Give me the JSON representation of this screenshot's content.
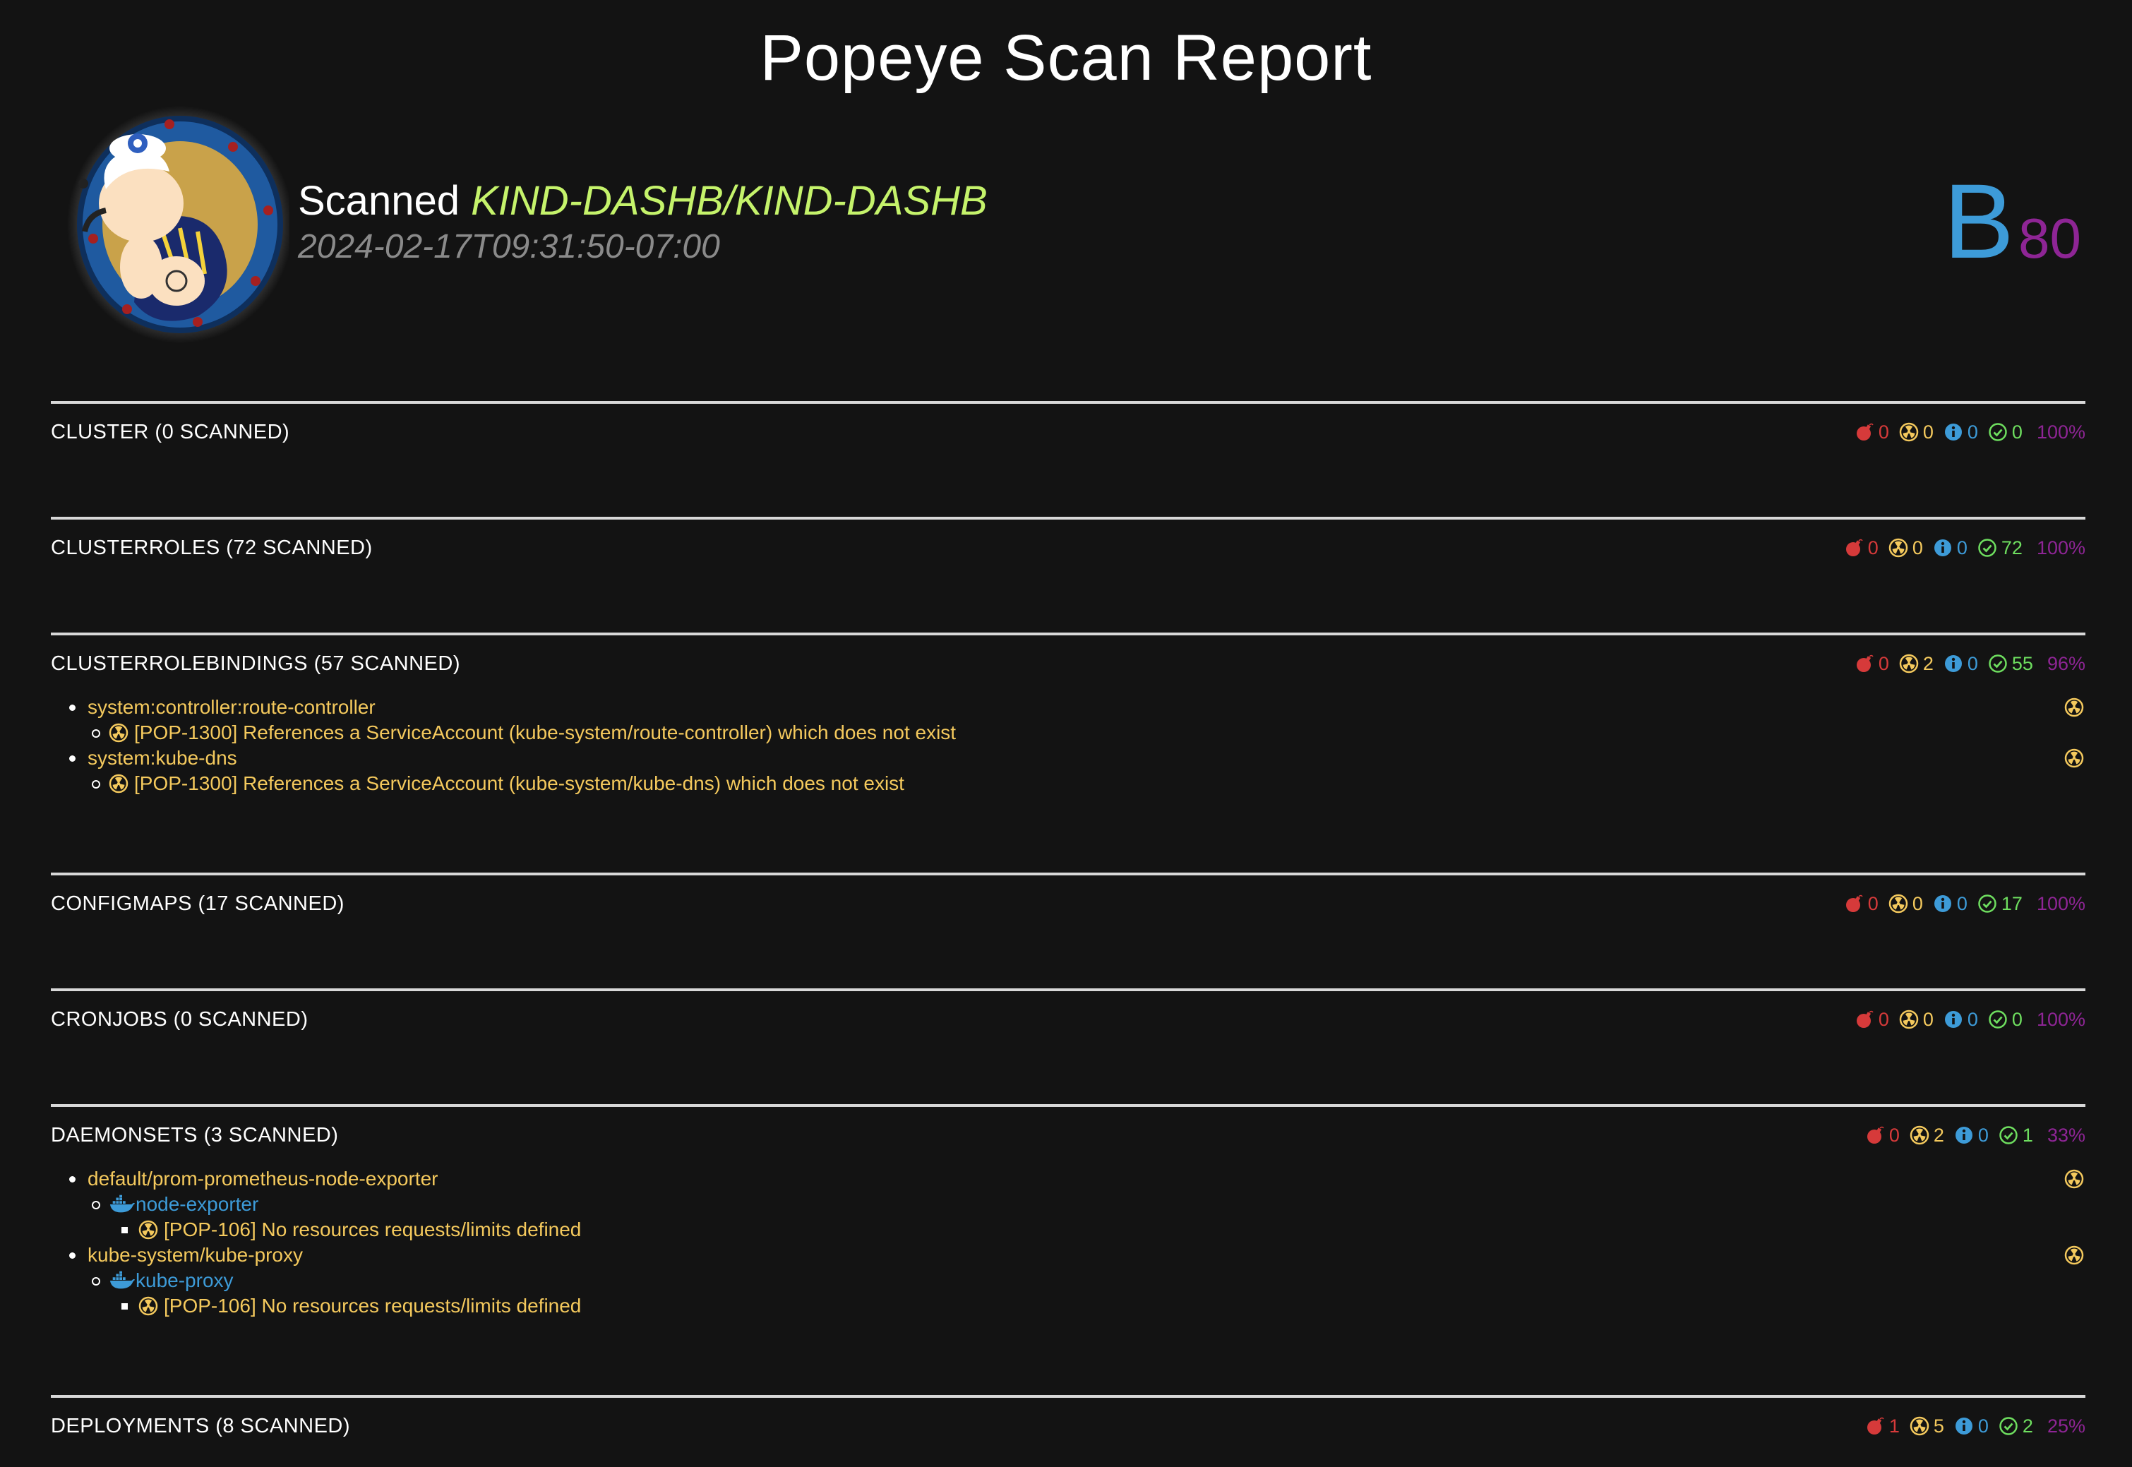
{
  "page": {
    "title": "Popeye Scan Report"
  },
  "header": {
    "scanned_label": "Scanned",
    "cluster": "KIND-DASHB/KIND-DASHB",
    "timestamp": "2024-02-17T09:31:50-07:00",
    "grade": "B",
    "score": "80"
  },
  "colors": {
    "background": "#131313",
    "error": "#d63a3a",
    "warning": "#f4c95d",
    "info": "#3d9bd8",
    "ok": "#6ede5f",
    "percent": "#8e2595",
    "cluster": "#c5f36b"
  },
  "sections": [
    {
      "title": "CLUSTER (0 SCANNED)",
      "error": "0",
      "warning": "0",
      "info": "0",
      "ok": "0",
      "percent": "100%",
      "issues": []
    },
    {
      "title": "CLUSTERROLES (72 SCANNED)",
      "error": "0",
      "warning": "0",
      "info": "0",
      "ok": "72",
      "percent": "100%",
      "issues": []
    },
    {
      "title": "CLUSTERROLEBINDINGS (57 SCANNED)",
      "error": "0",
      "warning": "2",
      "info": "0",
      "ok": "55",
      "percent": "96%",
      "issues": [
        {
          "name": "system:controller:route-controller",
          "message": "[POP-1300] References a ServiceAccount (kube-system/route-controller) which does not exist"
        },
        {
          "name": "system:kube-dns",
          "message": "[POP-1300] References a ServiceAccount (kube-system/kube-dns) which does not exist"
        }
      ]
    },
    {
      "title": "CONFIGMAPS (17 SCANNED)",
      "error": "0",
      "warning": "0",
      "info": "0",
      "ok": "17",
      "percent": "100%",
      "issues": []
    },
    {
      "title": "CRONJOBS (0 SCANNED)",
      "error": "0",
      "warning": "0",
      "info": "0",
      "ok": "0",
      "percent": "100%",
      "issues": []
    },
    {
      "title": "DAEMONSETS (3 SCANNED)",
      "error": "0",
      "warning": "2",
      "info": "0",
      "ok": "1",
      "percent": "33%",
      "issues": [
        {
          "name": "default/prom-prometheus-node-exporter",
          "container": "node-exporter",
          "message": "[POP-106] No resources requests/limits defined"
        },
        {
          "name": "kube-system/kube-proxy",
          "container": "kube-proxy",
          "message": "[POP-106] No resources requests/limits defined"
        }
      ]
    },
    {
      "title": "DEPLOYMENTS (8 SCANNED)",
      "error": "1",
      "warning": "5",
      "info": "0",
      "ok": "2",
      "percent": "25%",
      "issues": []
    }
  ]
}
